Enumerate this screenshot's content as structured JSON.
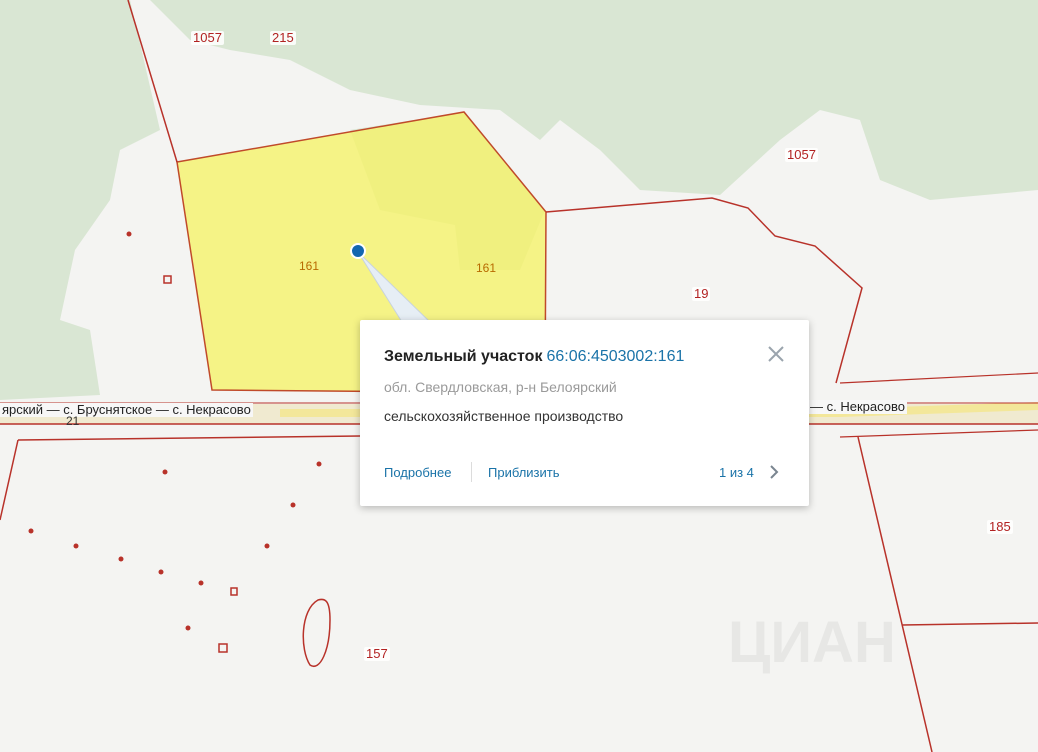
{
  "map": {
    "parcel_labels": [
      "161",
      "161"
    ],
    "cadastral_labels": {
      "n1057_a": "1057",
      "n215": "215",
      "n1057_b": "1057",
      "n19": "19",
      "n185": "185",
      "n157": "157"
    },
    "roads": {
      "left_text": "ярский — с. Бруснятское — с. Некрасово",
      "right_text": "— с. Некрасово",
      "road_number": "21"
    },
    "watermark": "ЦИАН",
    "colors": {
      "parcel_fill": "#f5f36a",
      "parcel_border": "#b8322a",
      "forest": "#d9e6d3",
      "boundary": "#b8322a",
      "road": "#f0e6a8",
      "marker": "#1467b0"
    }
  },
  "popup": {
    "title": "Земельный участок",
    "cadastral_number": "66:06:4503002:161",
    "address": "обл. Свердловская, р-н Белоярский",
    "usage": "сельскохозяйственное производство",
    "more_link": "Подробнее",
    "zoom_link": "Приблизить",
    "pager": "1 из 4"
  }
}
